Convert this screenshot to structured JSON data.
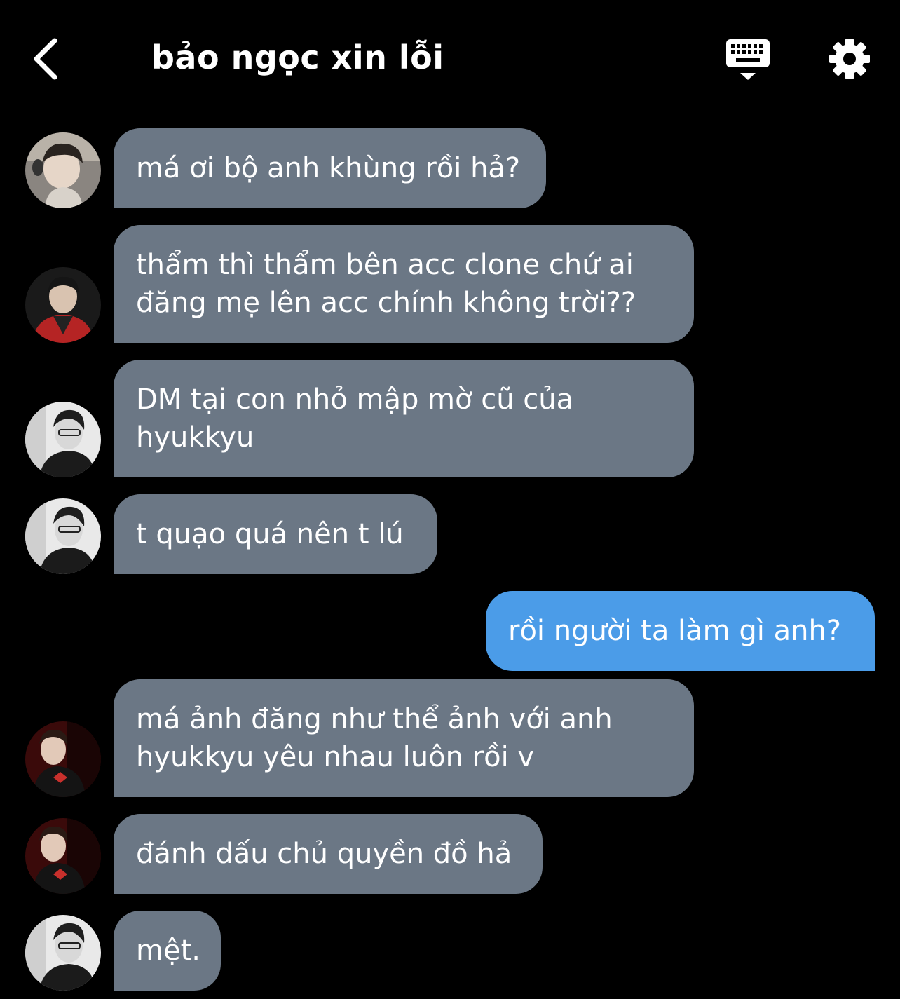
{
  "header": {
    "back_icon": "chevron-left-icon",
    "title": "bảo ngọc xin lỗi",
    "keyboard_icon": "keyboard-icon",
    "settings_icon": "gear-icon"
  },
  "messages": [
    {
      "sender": "other",
      "avatar": "avatar-photo-1",
      "lines": [
        "má ơi bộ anh khùng rồi hả?"
      ]
    },
    {
      "sender": "other",
      "avatar": "avatar-photo-2",
      "lines": [
        "thẩm thì thẩm bên acc clone chứ ai",
        "đăng mẹ lên acc chính không trời??"
      ]
    },
    {
      "sender": "other",
      "avatar": "avatar-photo-3",
      "lines": [
        "DM tại con nhỏ mập mờ cũ của",
        "hyukkyu"
      ]
    },
    {
      "sender": "other",
      "avatar": "avatar-photo-3",
      "lines": [
        "t quạo quá nên t lú"
      ]
    },
    {
      "sender": "me",
      "lines": [
        "rồi người ta làm gì anh?"
      ]
    },
    {
      "sender": "other",
      "avatar": "avatar-photo-4",
      "lines": [
        "má ảnh đăng như thể ảnh với anh",
        "hyukkyu yêu nhau luôn rồi v"
      ]
    },
    {
      "sender": "other",
      "avatar": "avatar-photo-4",
      "lines": [
        "đánh dấu chủ quyền đồ hả"
      ]
    },
    {
      "sender": "other",
      "avatar": "avatar-photo-3",
      "lines": [
        "mệt."
      ]
    }
  ],
  "colors": {
    "background": "#000000",
    "incoming_bubble": "#6b7785",
    "outgoing_bubble": "#4b9ce8",
    "text": "#ffffff"
  }
}
